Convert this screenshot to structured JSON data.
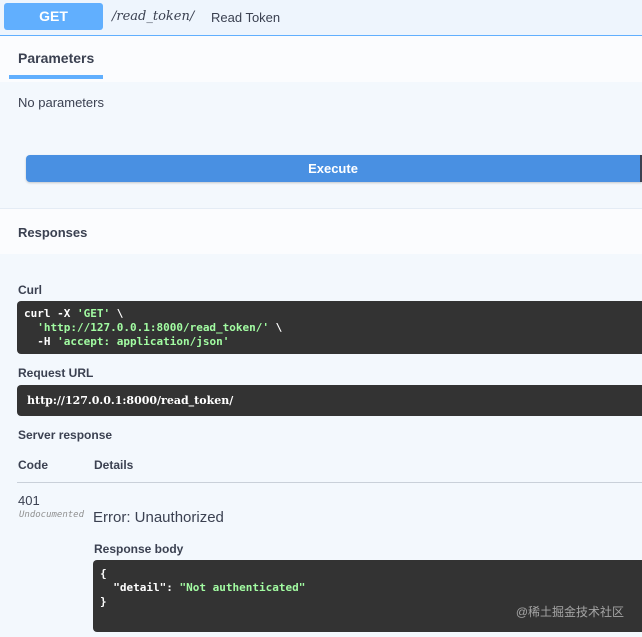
{
  "operation": {
    "method": "GET",
    "path": "/read_token/",
    "summary": "Read Token"
  },
  "parameters": {
    "tab_label": "Parameters",
    "empty_text": "No parameters"
  },
  "execute": {
    "label": "Execute"
  },
  "responses": {
    "title": "Responses",
    "curl_label": "Curl",
    "curl_lines": {
      "line1_cmd": "curl -X ",
      "line1_method": "'GET'",
      "line1_end": " \\",
      "line2_url": "'http://127.0.0.1:8000/read_token/'",
      "line2_end": " \\",
      "line3_flag": "-H ",
      "line3_header": "'accept: application/json'"
    },
    "request_url_label": "Request URL",
    "request_url": "http://127.0.0.1:8000/read_token/",
    "server_response_label": "Server response",
    "columns": {
      "code": "Code",
      "details": "Details"
    },
    "row": {
      "code": "401",
      "badge": "Undocumented",
      "error": "Error: Unauthorized",
      "body_label": "Response body",
      "body_open": "{",
      "body_key": "\"detail\"",
      "body_colon": ": ",
      "body_value": "\"Not authenticated\"",
      "body_close": "}"
    }
  },
  "watermark": "@稀土掘金技术社区",
  "colors": {
    "get_accent": "#61affe",
    "execute_button": "#4990e2",
    "code_bg": "#333333",
    "code_string": "#a2fca2"
  }
}
